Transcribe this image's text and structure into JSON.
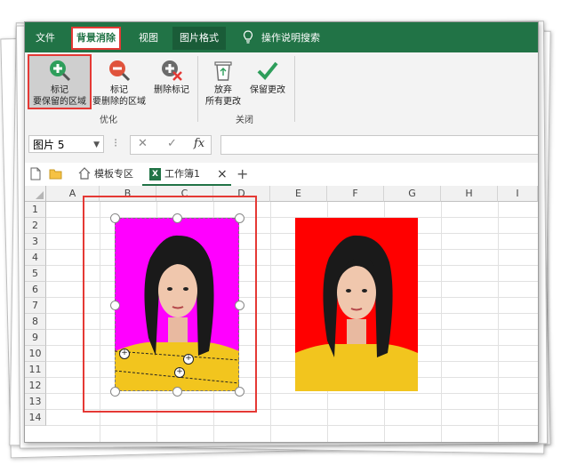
{
  "ribbon_tabs": {
    "file": "文件",
    "bg_removal": "背景消除",
    "view": "视图",
    "picture_format": "图片格式",
    "search_help": "操作说明搜索"
  },
  "ribbon": {
    "mark_keep_line1": "标记",
    "mark_keep_line2": "要保留的区域",
    "mark_remove_line1": "标记",
    "mark_remove_line2": "要删除的区域",
    "delete_mark": "删除标记",
    "discard_line1": "放弃",
    "discard_line2": "所有更改",
    "keep_changes": "保留更改",
    "group_refine": "优化",
    "group_close": "关闭"
  },
  "formula_bar": {
    "name_box": "图片 5",
    "cancel_symbol": "✕",
    "enter_symbol": "✓",
    "fx_symbol": "fx",
    "formula_value": ""
  },
  "doc_tabs": {
    "template_zone": "模板专区",
    "workbook": "工作簿1",
    "close": "×",
    "new_tab": "+"
  },
  "columns": [
    "A",
    "B",
    "C",
    "D",
    "E",
    "F",
    "G",
    "H",
    "I"
  ],
  "rows": [
    "1",
    "2",
    "3",
    "4",
    "5",
    "6",
    "7",
    "8",
    "9",
    "10",
    "11",
    "12",
    "13",
    "14"
  ],
  "colors": {
    "excel_green": "#217346",
    "highlight_red": "#e53935",
    "removed_area_magenta": "#ff00ff",
    "photo_bg_red": "#ff0000",
    "shirt_yellow": "#f2c51e"
  }
}
